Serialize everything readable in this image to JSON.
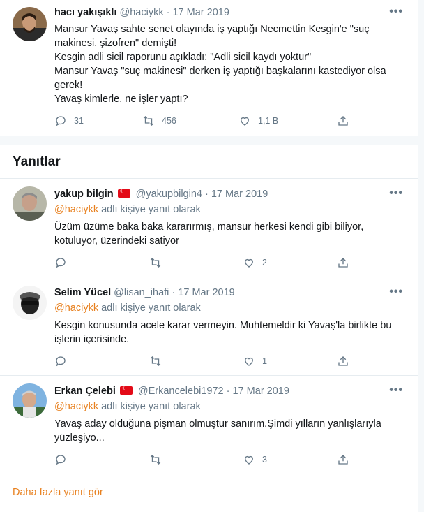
{
  "main_tweet": {
    "name": "hacı yakışıklı",
    "handle": "@haciykk",
    "date": "17 Mar 2019",
    "more": "•••",
    "lines": [
      "Mansur Yavaş sahte senet olayında iş yaptığı Necmettin Kesgin'e \"suç",
      "makinesi, şizofren\" demişti!",
      "Kesgin adli sicil raporunu açıkladı: \"Adli sicil kaydı yoktur\"",
      "Mansur Yavaş \"suç makinesi\" derken iş yaptığı başkalarını kastediyor olsa",
      "gerek!",
      "Yavaş kimlerle, ne işler yaptı?"
    ],
    "replies": "31",
    "retweets": "456",
    "likes": "1,1 B"
  },
  "replies_heading": "Yanıtlar",
  "replies": [
    {
      "name": "yakup bilgin",
      "flag": true,
      "handle": "@yakupbilgin4",
      "date": "17 Mar 2019",
      "reply_to_mention": "@haciykk",
      "reply_to_suffix": "adlı kişiye yanıt olarak",
      "lines": [
        "Üzüm üzüme baka baka kararırmış, mansur herkesi kendi gibi biliyor,",
        "kotuluyor, üzerindeki satiyor"
      ],
      "likes": "2"
    },
    {
      "name": "Selim Yücel",
      "flag": false,
      "handle": "@lisan_ihafi",
      "date": "17 Mar 2019",
      "reply_to_mention": "@haciykk",
      "reply_to_suffix": "adlı kişiye yanıt olarak",
      "lines": [
        "Kesgin konusunda acele karar vermeyin. Muhtemeldir ki Yavaş'la birlikte bu",
        "işlerin içerisinde."
      ],
      "likes": "1"
    },
    {
      "name": "Erkan Çelebi",
      "flag": true,
      "handle": "@Erkancelebi1972",
      "date": "17 Mar 2019",
      "reply_to_mention": "@haciykk",
      "reply_to_suffix": "adlı kişiye yanıt olarak",
      "lines": [
        "Yavaş aday olduğuna pişman olmuştur sanırım.Şimdi yılların yanlışlarıyla",
        "yüzleşiyo..."
      ],
      "likes": "3"
    }
  ],
  "more_replies_label": "Daha fazla yanıt gör",
  "colors": {
    "accent": "#e8801e",
    "muted": "#657786",
    "text": "#14171a",
    "divider": "#e6ecf0"
  },
  "icons": [
    "reply-icon",
    "retweet-icon",
    "like-icon",
    "share-icon",
    "more-icon"
  ]
}
